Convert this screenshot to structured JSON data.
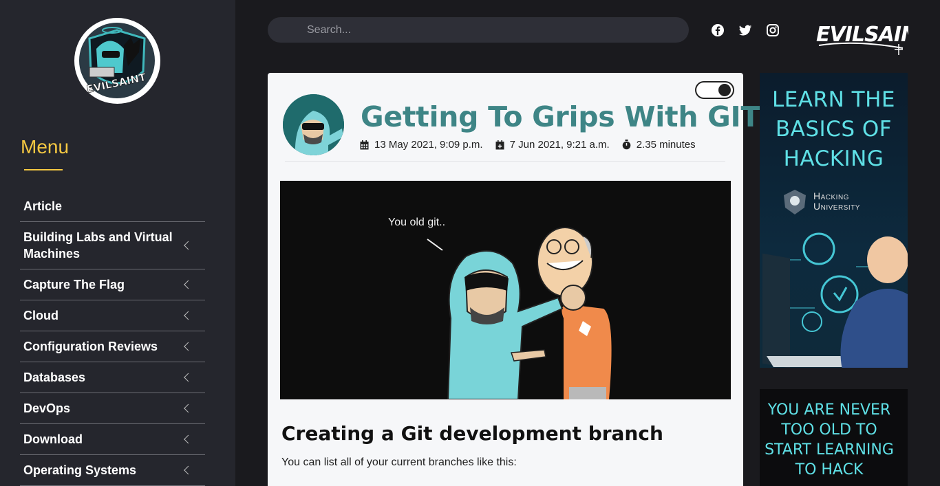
{
  "sidebar": {
    "logo_alt": "EvilSaint logo",
    "menu_title": "Menu",
    "items": [
      {
        "label": "Article",
        "has_children": false
      },
      {
        "label": "Building Labs and Virtual Machines",
        "has_children": true
      },
      {
        "label": "Capture The Flag",
        "has_children": true
      },
      {
        "label": "Cloud",
        "has_children": true
      },
      {
        "label": "Configuration Reviews",
        "has_children": true
      },
      {
        "label": "Databases",
        "has_children": true
      },
      {
        "label": "DevOps",
        "has_children": true
      },
      {
        "label": "Download",
        "has_children": true
      },
      {
        "label": "Operating Systems",
        "has_children": true
      }
    ]
  },
  "header": {
    "search_placeholder": "Search...",
    "social": [
      "facebook-icon",
      "twitter-icon",
      "instagram-icon"
    ],
    "brand": "EVILSAINT"
  },
  "article": {
    "title": "Getting To Grips With GIT",
    "created": "13 May 2021, 9:09 p.m.",
    "updated": "7 Jun 2021, 9:21 a.m.",
    "read_time": "2.35 minutes",
    "hero_caption": "You old git..",
    "section_heading": "Creating a Git development branch",
    "paragraph": "You can list all of your current branches like this:"
  },
  "ads": {
    "ad1_headline": "LEARN THE BASICS OF HACKING",
    "ad1_brand_line1": "Hacking",
    "ad1_brand_line2": "University",
    "ad2_headline": "YOU ARE NEVER TOO OLD TO START LEARNING TO HACK"
  },
  "colors": {
    "accent_yellow": "#f5c842",
    "title_teal": "#3e8586",
    "sidebar_bg": "#25262d",
    "page_bg": "#1a1a1e",
    "ad_cyan": "#5fe0e6"
  }
}
